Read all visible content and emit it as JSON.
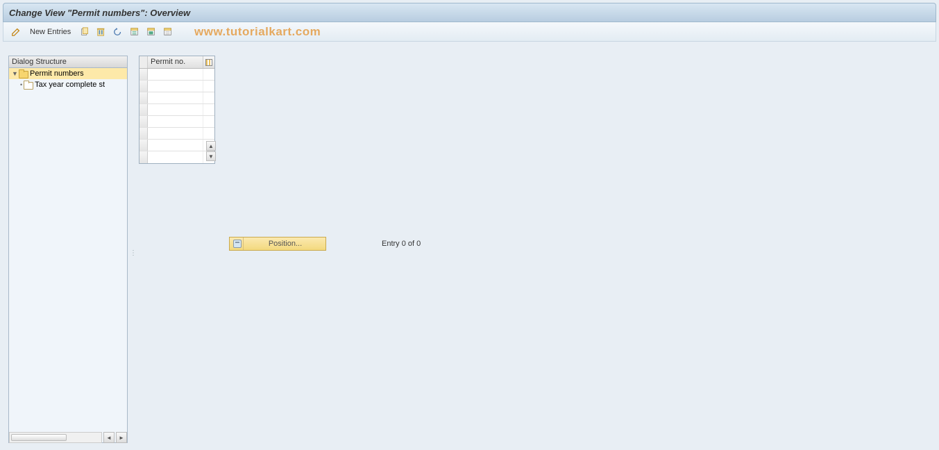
{
  "title": "Change View \"Permit numbers\": Overview",
  "toolbar": {
    "new_entries_label": "New Entries"
  },
  "watermark": "www.tutorialkart.com",
  "dialog_structure": {
    "header": "Dialog Structure",
    "items": [
      {
        "label": "Permit numbers",
        "selected": true,
        "icon": "folder-open",
        "expanded": true
      },
      {
        "label": "Tax year complete st",
        "selected": false,
        "icon": "folder-closed",
        "expanded": false
      }
    ]
  },
  "table": {
    "columns": [
      {
        "label": "Permit no."
      }
    ],
    "rows": [
      {},
      {},
      {},
      {},
      {},
      {},
      {},
      {}
    ]
  },
  "position": {
    "button_label": "Position...",
    "entry_text": "Entry 0 of 0"
  }
}
